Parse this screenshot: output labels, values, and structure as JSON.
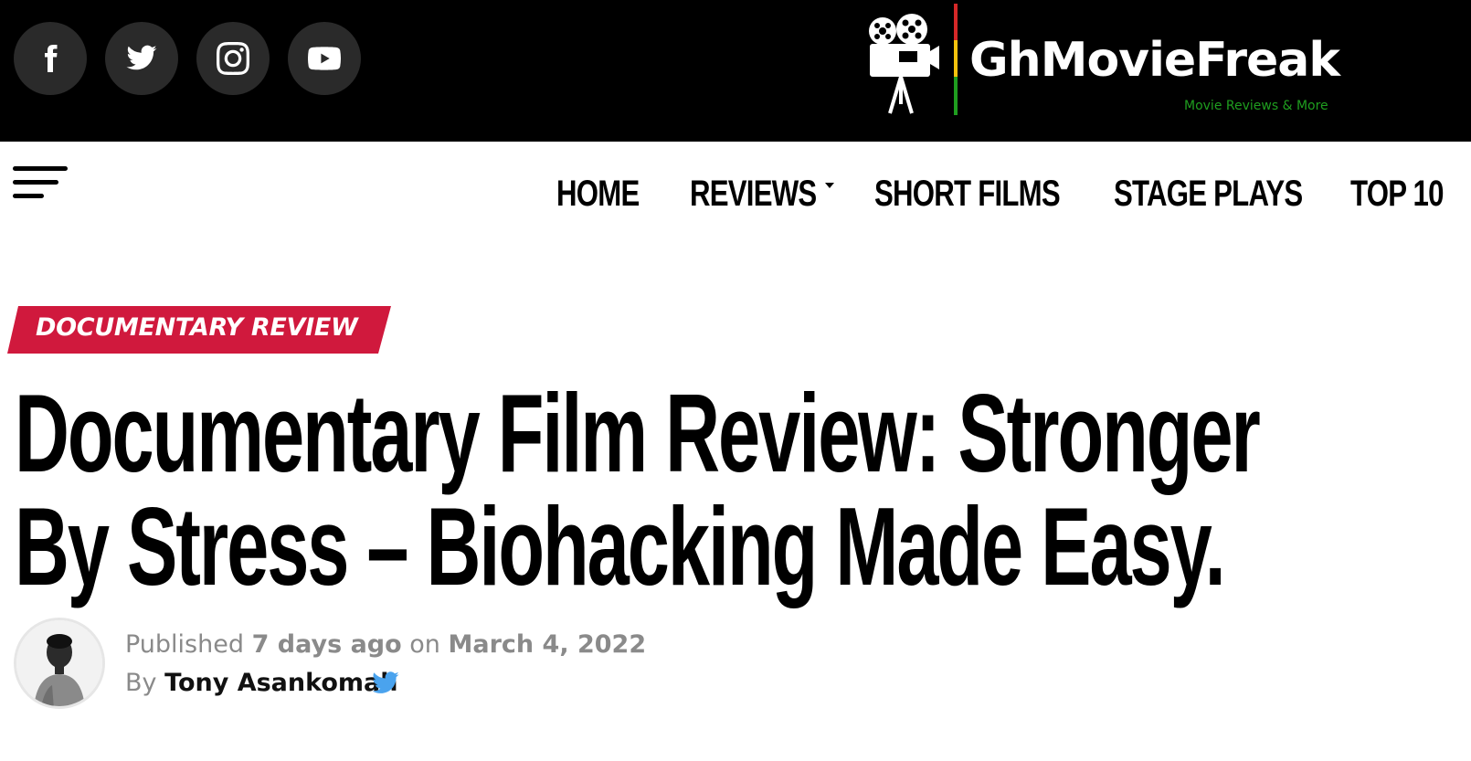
{
  "header": {
    "social": [
      {
        "name": "facebook-icon"
      },
      {
        "name": "twitter-icon"
      },
      {
        "name": "instagram-icon"
      },
      {
        "name": "youtube-icon"
      }
    ],
    "logo": {
      "name": "GhMovieFreak",
      "tagline": "Movie Reviews & More",
      "colors": {
        "red": "#d62828",
        "yellow": "#f4c20d",
        "green": "#1f9e1f"
      }
    }
  },
  "nav": {
    "menu_icon": "hamburger-menu-icon",
    "items": [
      "HOME",
      "REVIEWS",
      "SHORT FILMS",
      "STAGE PLAYS",
      "TOP 10"
    ]
  },
  "article": {
    "category": "DOCUMENTARY REVIEW",
    "title_line1": "Documentary Film Review: Stronger",
    "title_line2": "By Stress – Biohacking Made Easy.",
    "published_prefix": "Published",
    "published_ago": "7 days ago",
    "published_on": "on",
    "published_date": "March 4, 2022",
    "by": "By",
    "author": "Tony Asankomah",
    "author_social_icon": "twitter-icon"
  },
  "colors": {
    "topbar": "#000000",
    "category_bg": "#d0193d",
    "meta_text": "#8a8a8a",
    "twitter_blue": "#4aa3ee"
  }
}
